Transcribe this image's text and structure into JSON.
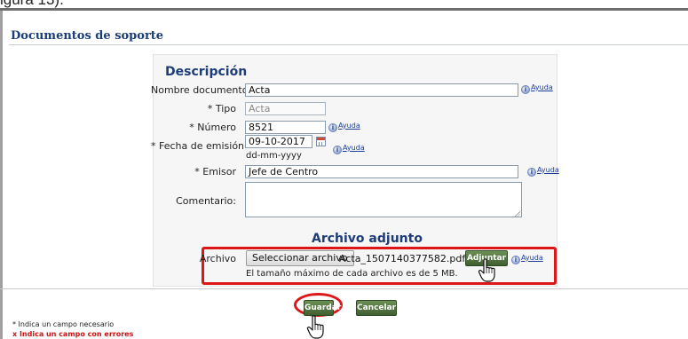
{
  "caption_fragment": "igura 13).",
  "section_title": "Documentos de soporte",
  "description": {
    "heading": "Descripción",
    "nombre_label": "Nombre documento",
    "nombre_value": "Acta",
    "tipo_label": "* Tipo",
    "tipo_value": "Acta",
    "numero_label": "* Número",
    "numero_value": "8521",
    "fecha_label": "* Fecha de emisión",
    "fecha_value": "09-10-2017",
    "fecha_format": "dd-mm-yyyy",
    "emisor_label": "* Emisor",
    "emisor_value": "Jefe de Centro",
    "comentario_label": "Comentario:",
    "comentario_value": "",
    "help_label": "Ayuda"
  },
  "attachment": {
    "heading": "Archivo adjunto",
    "archivo_label": "Archivo",
    "choose_button": "Seleccionar archivo",
    "file_name": "Acta_1507140377582.pdf",
    "attach_button": "Adjuntar",
    "help_label": "Ayuda",
    "size_note": "El tamaño máximo de cada archivo es de 5 MB."
  },
  "actions": {
    "save_button": "Guardar",
    "cancel_button": "Cancelar"
  },
  "legend": {
    "required": "* Indica un campo necesario",
    "error": "x Indica un campo con errores"
  },
  "colors": {
    "title_blue": "#1b3d78",
    "highlight_red": "#dd1717",
    "button_green": "#4f7040"
  },
  "icons": {
    "help": "info-circle-icon",
    "calendar": "calendar-icon",
    "cursor": "hand-pointer-icon"
  }
}
